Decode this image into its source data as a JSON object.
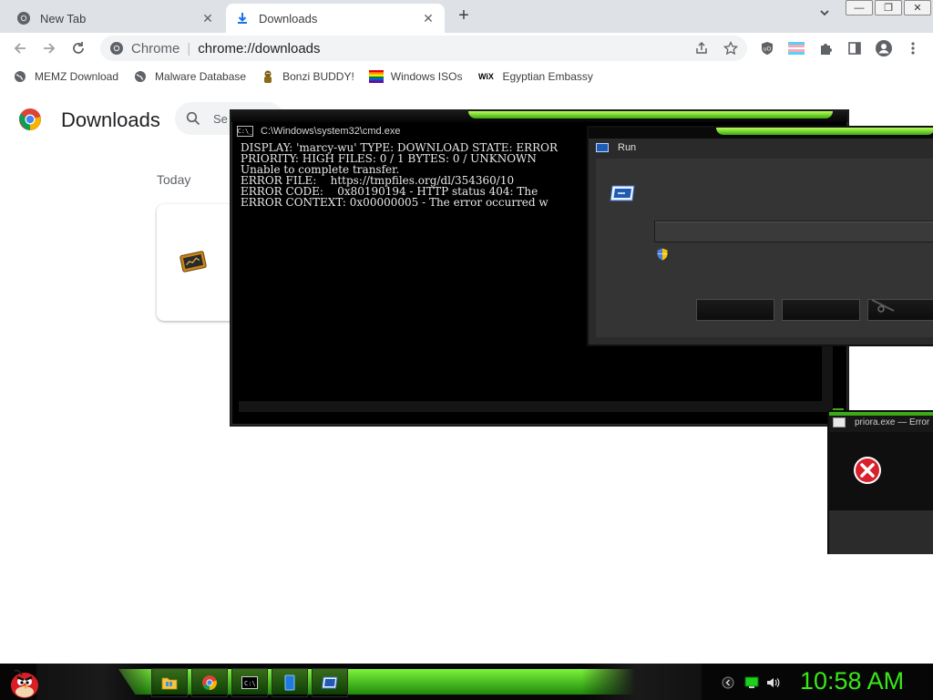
{
  "browser": {
    "tabs": [
      {
        "label": "New Tab",
        "icon": "chrome-icon"
      },
      {
        "label": "Downloads",
        "icon": "download-icon"
      }
    ],
    "new_tab": "+",
    "tab_close": "✕",
    "omnibox": {
      "site_label": "Chrome",
      "separator": "|",
      "url": "chrome://downloads"
    },
    "bookmarks": [
      {
        "label": "MEMZ Download",
        "icon": "globe-icon"
      },
      {
        "label": "Malware Database",
        "icon": "globe-icon"
      },
      {
        "label": "Bonzi BUDDY!",
        "icon": "bonzi-icon"
      },
      {
        "label": "Windows ISOs",
        "icon": "windows-flag-icon"
      },
      {
        "label": "Egyptian Embassy",
        "icon": "wix-icon"
      }
    ]
  },
  "downloads_page": {
    "title": "Downloads",
    "search_placeholder": "Se",
    "section_today": "Today"
  },
  "cmd_window": {
    "title": "C:\\Windows\\system32\\cmd.exe",
    "icon_text": "C:\\_",
    "lines": [
      "DISPLAY: 'marcy-wu' TYPE: DOWNLOAD STATE: ERROR",
      "PRIORITY: HIGH FILES: 0 / 1 BYTES: 0 / UNKNOWN",
      "Unable to complete transfer.",
      "ERROR FILE:    https://tmpfiles.org/dl/354360/10",
      "ERROR CODE:    0x80190194 - HTTP status 404: The",
      "ERROR CONTEXT: 0x00000005 - The error occurred w"
    ]
  },
  "run_window": {
    "title": "Run"
  },
  "error_dialog": {
    "title": "priora.exe — Error"
  },
  "taskbar": {
    "clock": "10:58 AM",
    "pinned": [
      "file-explorer-icon",
      "chrome-icon",
      "cmd-icon",
      "notepad-icon",
      "run-icon"
    ],
    "tray": [
      "back-icon",
      "network-icon",
      "volume-icon"
    ]
  },
  "colors": {
    "accent_green": "#3cab17",
    "clock_green": "#39e819",
    "chrome_tab_bg": "#dee1e6"
  }
}
